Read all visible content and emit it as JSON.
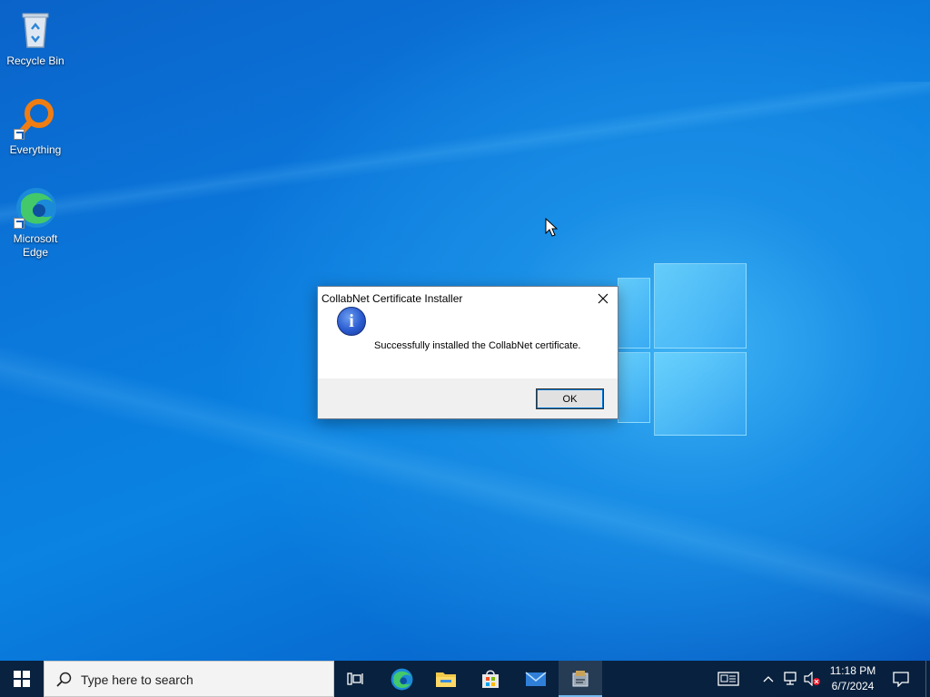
{
  "desktop": {
    "icons": [
      {
        "label": "Recycle Bin"
      },
      {
        "label": "Everything"
      },
      {
        "label": "Microsoft Edge"
      }
    ]
  },
  "dialog": {
    "title": "CollabNet Certificate Installer",
    "message": "Successfully installed the CollabNet certificate.",
    "ok_label": "OK",
    "icon": "info-icon"
  },
  "taskbar": {
    "search_placeholder": "Type here to search",
    "apps": [
      "task-view-icon",
      "edge-icon",
      "file-explorer-icon",
      "store-icon",
      "mail-icon",
      "installer-icon"
    ],
    "active_app": "installer-icon"
  },
  "clock": {
    "time": "11:18 PM",
    "date": "6/7/2024"
  },
  "colors": {
    "accent": "#0078d7",
    "taskbar": "#081e38"
  }
}
